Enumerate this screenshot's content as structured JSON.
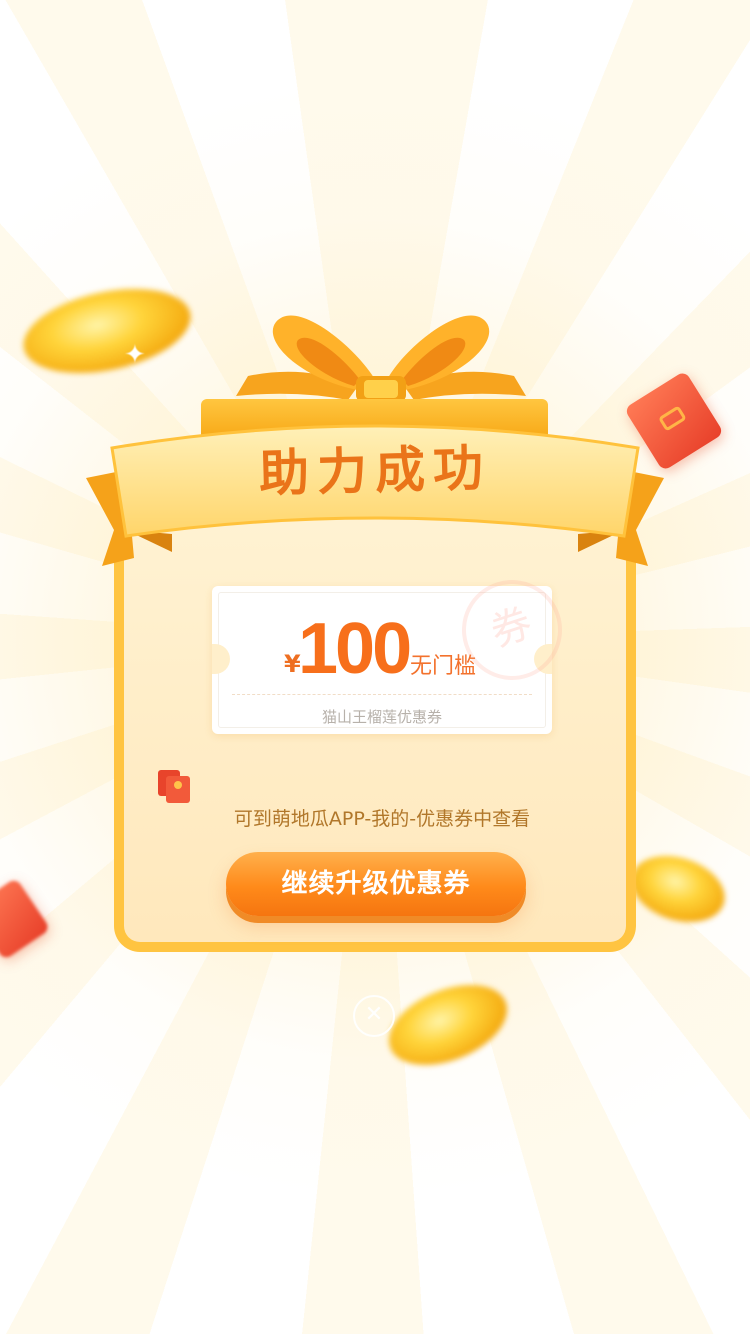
{
  "popup": {
    "title": "助力成功",
    "cta_label": "继续升级优惠券",
    "hint_text": "可到萌地瓜APP-我的-优惠券中查看",
    "close_icon": "close-icon"
  },
  "coupon": {
    "currency": "¥",
    "amount": "100",
    "condition": "无门槛",
    "description": "猫山王榴莲优惠券",
    "stamp": "券"
  },
  "colors": {
    "accent_orange": "#f76f1b",
    "frame_gold": "#ffc441",
    "card_bg": "#ffefcb",
    "hint_brown": "#b1772a"
  }
}
